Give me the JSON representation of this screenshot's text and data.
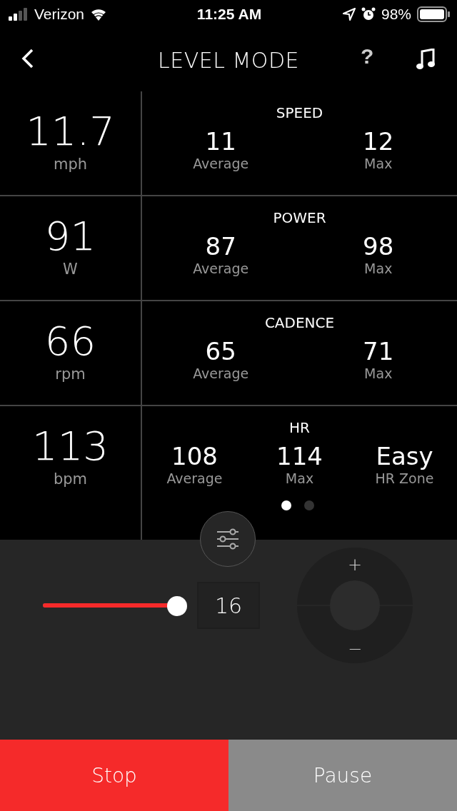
{
  "status_bar": {
    "carrier": "Verizon",
    "time": "11:25 AM",
    "battery": "98%"
  },
  "header": {
    "title": "LEVEL MODE",
    "help": "?"
  },
  "stats": [
    {
      "value": "11.7",
      "unit": "mph",
      "title": "SPEED",
      "metrics": [
        {
          "value": "11",
          "label": "Average"
        },
        {
          "value": "12",
          "label": "Max"
        }
      ]
    },
    {
      "value": "91",
      "unit": "W",
      "title": "POWER",
      "metrics": [
        {
          "value": "87",
          "label": "Average"
        },
        {
          "value": "98",
          "label": "Max"
        }
      ]
    },
    {
      "value": "66",
      "unit": "rpm",
      "title": "CADENCE",
      "metrics": [
        {
          "value": "65",
          "label": "Average"
        },
        {
          "value": "71",
          "label": "Max"
        }
      ]
    },
    {
      "value": "113",
      "unit": "bpm",
      "title": "HR",
      "metrics": [
        {
          "value": "108",
          "label": "Average"
        },
        {
          "value": "114",
          "label": "Max"
        },
        {
          "value": "Easy",
          "label": "HR Zone"
        }
      ]
    }
  ],
  "pages": [
    {
      "selected": true
    },
    {
      "selected": false
    }
  ],
  "level": {
    "level": 1.0,
    "value": "16",
    "plus": "+",
    "minus": "−"
  },
  "buttons": [
    {
      "label": "Stop",
      "kind": "primary"
    },
    {
      "label": "Pause",
      "kind": "secondary"
    }
  ]
}
